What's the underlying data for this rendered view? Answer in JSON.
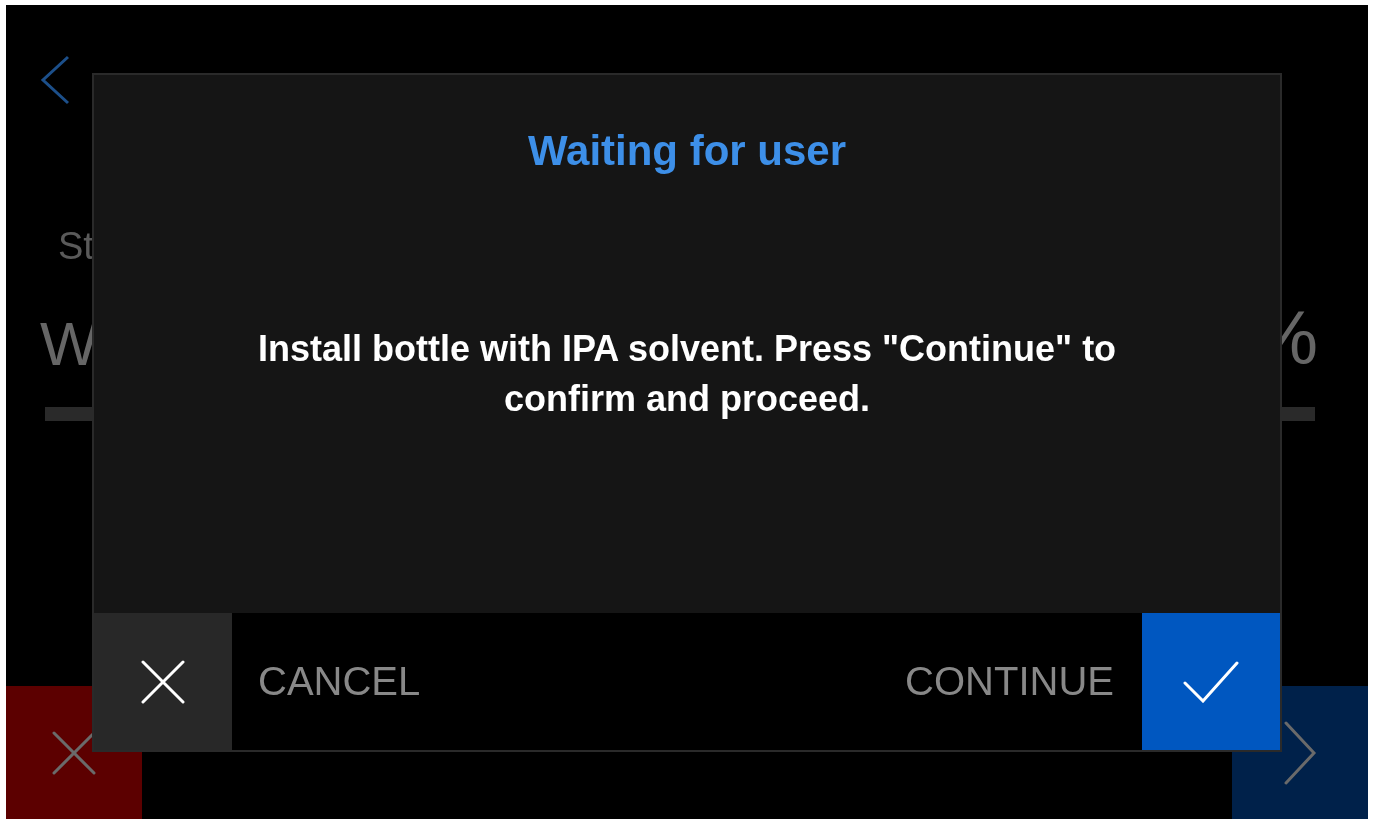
{
  "screen": {
    "status_label": "St",
    "progress_label": "W",
    "progress_percent": "%",
    "buttons": [
      {
        "kind": "cancel"
      },
      {
        "kind": "skip"
      }
    ]
  },
  "dialog": {
    "title": "Waiting for user",
    "message": "Install bottle with IPA solvent. Press \"Continue\" to confirm and proceed.",
    "buttons": [
      {
        "kind": "cancel",
        "label": "CANCEL"
      },
      {
        "kind": "confirm",
        "label": "CONTINUE"
      }
    ]
  }
}
